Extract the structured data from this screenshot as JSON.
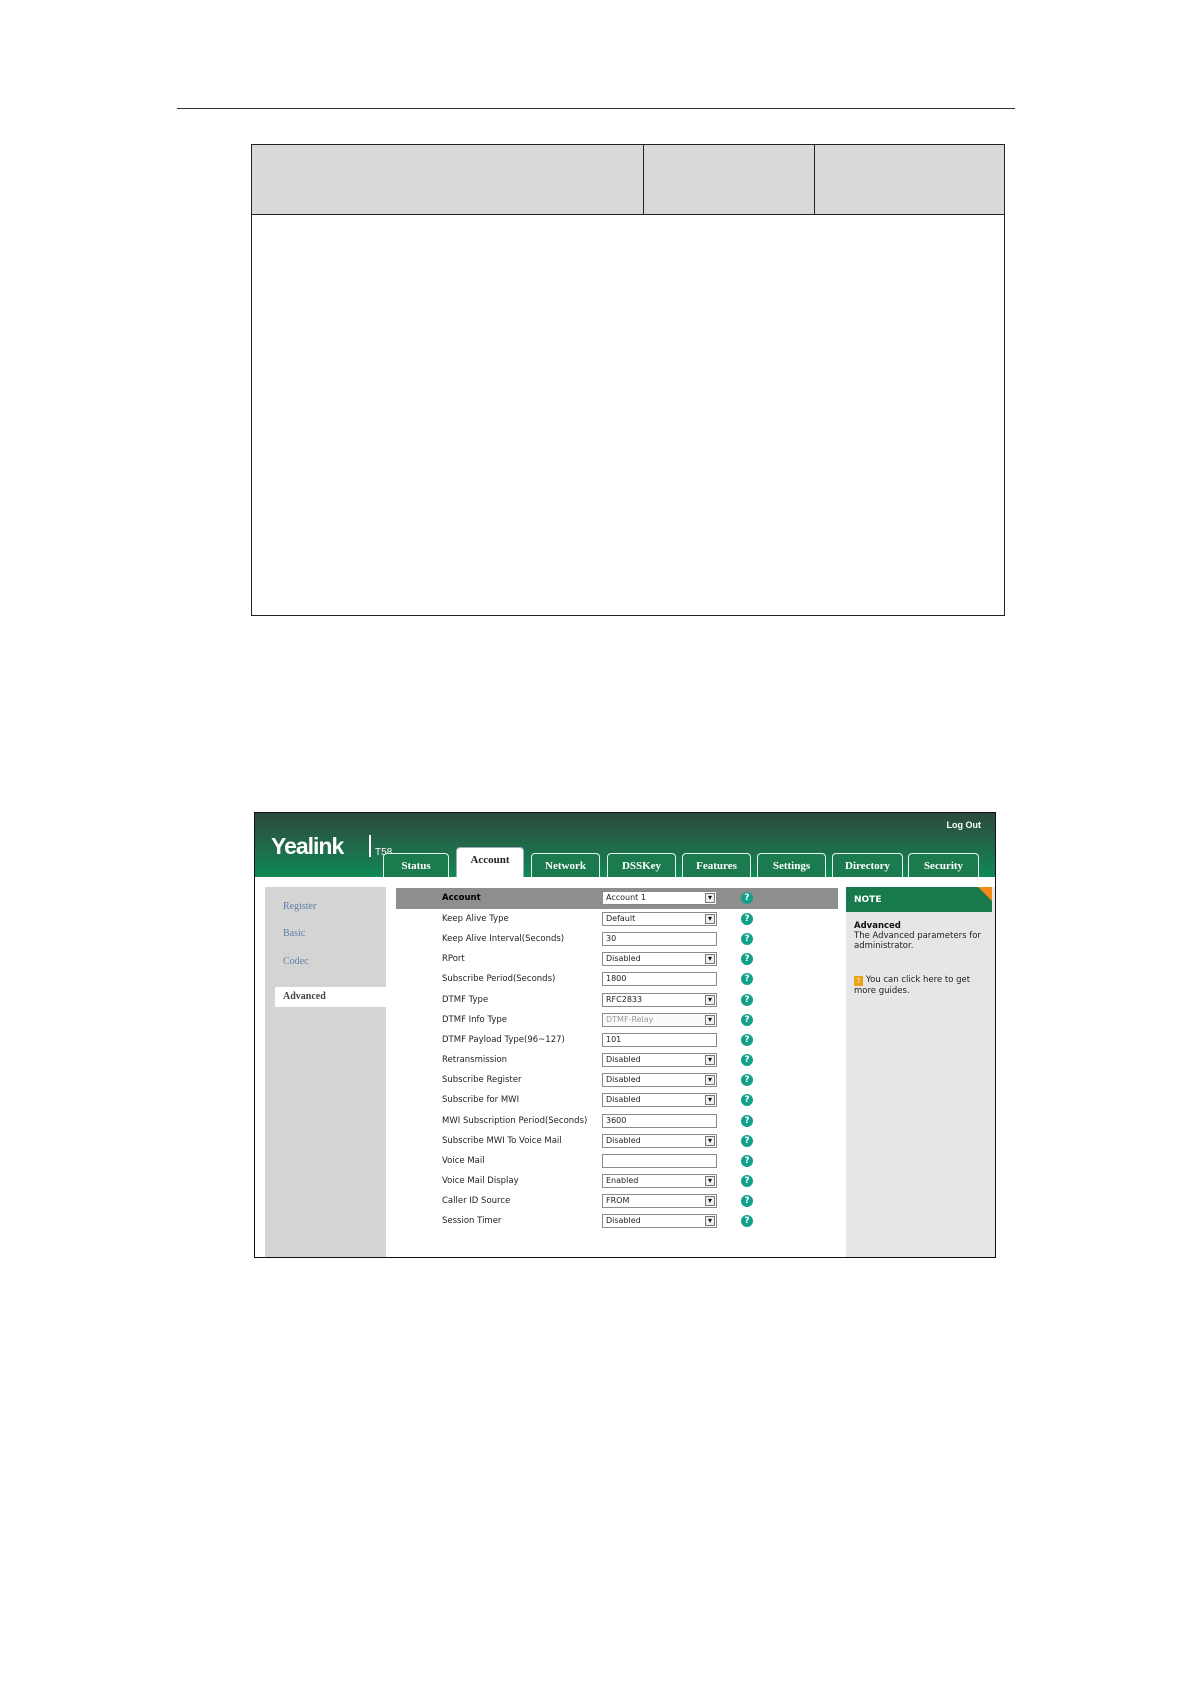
{
  "screenshot": {
    "logo": "Yealink",
    "model": "T58",
    "logout": "Log Out",
    "tabs": [
      "Status",
      "Account",
      "Network",
      "DSSKey",
      "Features",
      "Settings",
      "Directory",
      "Security"
    ],
    "active_tab": "Account",
    "sidebar": [
      "Register",
      "Basic",
      "Codec"
    ],
    "sidebar_active": "Advanced",
    "form": {
      "header": {
        "label": "Account",
        "value": "Account 1"
      },
      "rows": [
        {
          "label": "Keep Alive Type",
          "value": "Default",
          "type": "select"
        },
        {
          "label": "Keep Alive Interval(Seconds)",
          "value": "30",
          "type": "text"
        },
        {
          "label": "RPort",
          "value": "Disabled",
          "type": "select"
        },
        {
          "label": "Subscribe Period(Seconds)",
          "value": "1800",
          "type": "text"
        },
        {
          "label": "DTMF Type",
          "value": "RFC2833",
          "type": "select"
        },
        {
          "label": "DTMF Info Type",
          "value": "DTMF-Relay",
          "type": "select-disabled"
        },
        {
          "label": "DTMF Payload Type(96~127)",
          "value": "101",
          "type": "text"
        },
        {
          "label": "Retransmission",
          "value": "Disabled",
          "type": "select"
        },
        {
          "label": "Subscribe Register",
          "value": "Disabled",
          "type": "select"
        },
        {
          "label": "Subscribe for MWI",
          "value": "Disabled",
          "type": "select"
        },
        {
          "label": "MWI Subscription Period(Seconds)",
          "value": "3600",
          "type": "text"
        },
        {
          "label": "Subscribe MWI To Voice Mail",
          "value": "Disabled",
          "type": "select"
        },
        {
          "label": "Voice Mail",
          "value": "",
          "type": "text"
        },
        {
          "label": "Voice Mail Display",
          "value": "Enabled",
          "type": "select"
        },
        {
          "label": "Caller ID Source",
          "value": "FROM",
          "type": "select"
        },
        {
          "label": "Session Timer",
          "value": "Disabled",
          "type": "select"
        }
      ],
      "help_glyph": "?"
    },
    "note": {
      "title": "NOTE",
      "heading": "Advanced",
      "text": "The Advanced parameters for administrator.",
      "guide_icon": "?",
      "guide": "You can click here to get more guides."
    },
    "colors": {
      "brand_green": "#187a4c",
      "highlight": "#e0222a",
      "help": "#13a08a",
      "note_corner": "#f28a1a"
    }
  }
}
